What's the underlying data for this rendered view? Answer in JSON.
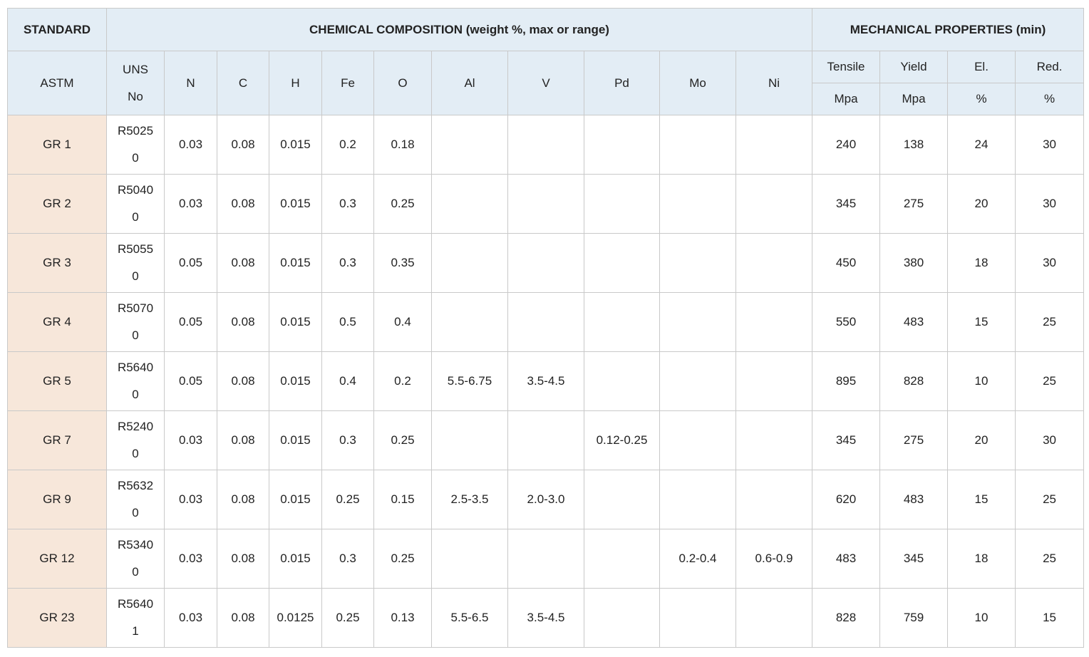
{
  "headers": {
    "standard": "STANDARD",
    "chemical": "CHEMICAL COMPOSITION (weight %, max or range)",
    "mechanical": "MECHANICAL PROPERTIES (min)",
    "astm": "ASTM",
    "uns_line1": "UNS",
    "uns_line2": "No",
    "elements": [
      "N",
      "C",
      "H",
      "Fe",
      "O",
      "Al",
      "V",
      "Pd",
      "Mo",
      "Ni"
    ],
    "mech": [
      {
        "name": "Tensile",
        "unit": "Mpa"
      },
      {
        "name": "Yield",
        "unit": "Mpa"
      },
      {
        "name": "El.",
        "unit": "%"
      },
      {
        "name": "Red.",
        "unit": "%"
      }
    ]
  },
  "rows": [
    {
      "grade": "GR 1",
      "uns1": "R5025",
      "uns2": "0",
      "N": "0.03",
      "C": "0.08",
      "H": "0.015",
      "Fe": "0.2",
      "O": "0.18",
      "Al": "",
      "V": "",
      "Pd": "",
      "Mo": "",
      "Ni": "",
      "tensile": "240",
      "yield": "138",
      "el": "24",
      "red": "30"
    },
    {
      "grade": "GR 2",
      "uns1": "R5040",
      "uns2": "0",
      "N": "0.03",
      "C": "0.08",
      "H": "0.015",
      "Fe": "0.3",
      "O": "0.25",
      "Al": "",
      "V": "",
      "Pd": "",
      "Mo": "",
      "Ni": "",
      "tensile": "345",
      "yield": "275",
      "el": "20",
      "red": "30"
    },
    {
      "grade": "GR 3",
      "uns1": "R5055",
      "uns2": "0",
      "N": "0.05",
      "C": "0.08",
      "H": "0.015",
      "Fe": "0.3",
      "O": "0.35",
      "Al": "",
      "V": "",
      "Pd": "",
      "Mo": "",
      "Ni": "",
      "tensile": "450",
      "yield": "380",
      "el": "18",
      "red": "30"
    },
    {
      "grade": "GR 4",
      "uns1": "R5070",
      "uns2": "0",
      "N": "0.05",
      "C": "0.08",
      "H": "0.015",
      "Fe": "0.5",
      "O": "0.4",
      "Al": "",
      "V": "",
      "Pd": "",
      "Mo": "",
      "Ni": "",
      "tensile": "550",
      "yield": "483",
      "el": "15",
      "red": "25"
    },
    {
      "grade": "GR 5",
      "uns1": "R5640",
      "uns2": "0",
      "N": "0.05",
      "C": "0.08",
      "H": "0.015",
      "Fe": "0.4",
      "O": "0.2",
      "Al": "5.5-6.75",
      "V": "3.5-4.5",
      "Pd": "",
      "Mo": "",
      "Ni": "",
      "tensile": "895",
      "yield": "828",
      "el": "10",
      "red": "25"
    },
    {
      "grade": "GR 7",
      "uns1": "R5240",
      "uns2": "0",
      "N": "0.03",
      "C": "0.08",
      "H": "0.015",
      "Fe": "0.3",
      "O": "0.25",
      "Al": "",
      "V": "",
      "Pd": "0.12-0.25",
      "Mo": "",
      "Ni": "",
      "tensile": "345",
      "yield": "275",
      "el": "20",
      "red": "30"
    },
    {
      "grade": "GR 9",
      "uns1": "R5632",
      "uns2": "0",
      "N": "0.03",
      "C": "0.08",
      "H": "0.015",
      "Fe": "0.25",
      "O": "0.15",
      "Al": "2.5-3.5",
      "V": "2.0-3.0",
      "Pd": "",
      "Mo": "",
      "Ni": "",
      "tensile": "620",
      "yield": "483",
      "el": "15",
      "red": "25"
    },
    {
      "grade": "GR 12",
      "uns1": "R5340",
      "uns2": "0",
      "N": "0.03",
      "C": "0.08",
      "H": "0.015",
      "Fe": "0.3",
      "O": "0.25",
      "Al": "",
      "V": "",
      "Pd": "",
      "Mo": "0.2-0.4",
      "Ni": "0.6-0.9",
      "tensile": "483",
      "yield": "345",
      "el": "18",
      "red": "25"
    },
    {
      "grade": "GR 23",
      "uns1": "R5640",
      "uns2": "1",
      "N": "0.03",
      "C": "0.08",
      "H": "0.0125",
      "Fe": "0.25",
      "O": "0.13",
      "Al": "5.5-6.5",
      "V": "3.5-4.5",
      "Pd": "",
      "Mo": "",
      "Ni": "",
      "tensile": "828",
      "yield": "759",
      "el": "10",
      "red": "15"
    }
  ],
  "colors": {
    "header_bg": "#e3edf5",
    "standard_col_bg": "#f7e7da",
    "border": "#c9c9c9"
  }
}
